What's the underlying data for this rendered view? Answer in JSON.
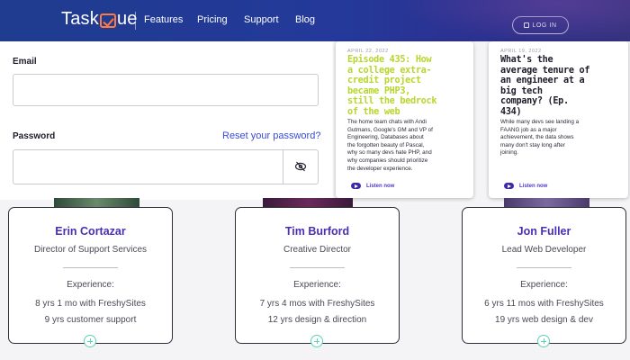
{
  "header": {
    "logo_left": "Task",
    "logo_right": "ue",
    "nav": [
      "Features",
      "Pricing",
      "Support",
      "Blog"
    ],
    "login_label": "LOG IN"
  },
  "form": {
    "email_label": "Email",
    "email_value": "",
    "password_label": "Password",
    "password_value": "",
    "reset_link": "Reset your password?"
  },
  "podcasts": [
    {
      "date": "APRIL 22, 2022",
      "title_lines": [
        "Episode 435: How",
        "a college extra-",
        "credit project",
        "became PHP3,",
        "still the bedrock",
        "of the web"
      ],
      "title_color": "#b7d62a",
      "desc_lines": [
        "The home team chats with Andi",
        "Gutmans, Google's GM and VP of",
        "Engineering, Databases about",
        "the forgotten beauty of Pascal,",
        "why so many devs hate PHP, and",
        "why companies should prioritize",
        "the developer experience."
      ],
      "listen": "Listen now"
    },
    {
      "date": "APRIL 19, 2022",
      "title_lines": [
        "What's the",
        "average tenure of",
        "an engineer at a",
        "big tech",
        "company? (Ep.",
        "434)"
      ],
      "title_color": "#1d1d2b",
      "desc_lines": [
        "While many devs see landing a",
        "FAANG job as a major",
        "achievement, the data shows",
        "many don't stay long after",
        "joining."
      ],
      "listen": "Listen now"
    }
  ],
  "team": [
    {
      "name": "Erin Cortazar",
      "role": "Director of Support Services",
      "experience_label": "Experience:",
      "line1": "8 yrs 1 mo with FreshySites",
      "line2": "9 yrs customer support"
    },
    {
      "name": "Tim Burford",
      "role": "Creative Director",
      "experience_label": "Experience:",
      "line1": "7 yrs 4 mos with FreshySites",
      "line2": "12 yrs design & direction"
    },
    {
      "name": "Jon Fuller",
      "role": "Lead Web Developer",
      "experience_label": "Experience:",
      "line1": "6 yrs 11 mos with FreshySites",
      "line2": "19 yrs web design & dev"
    }
  ],
  "colors": {
    "header_blue": "#24399a",
    "accent_orange": "#ff7a3c",
    "link_blue": "#3a4ad6",
    "name_purple": "#4a2eb5",
    "plus_teal": "#5fd3b6"
  }
}
